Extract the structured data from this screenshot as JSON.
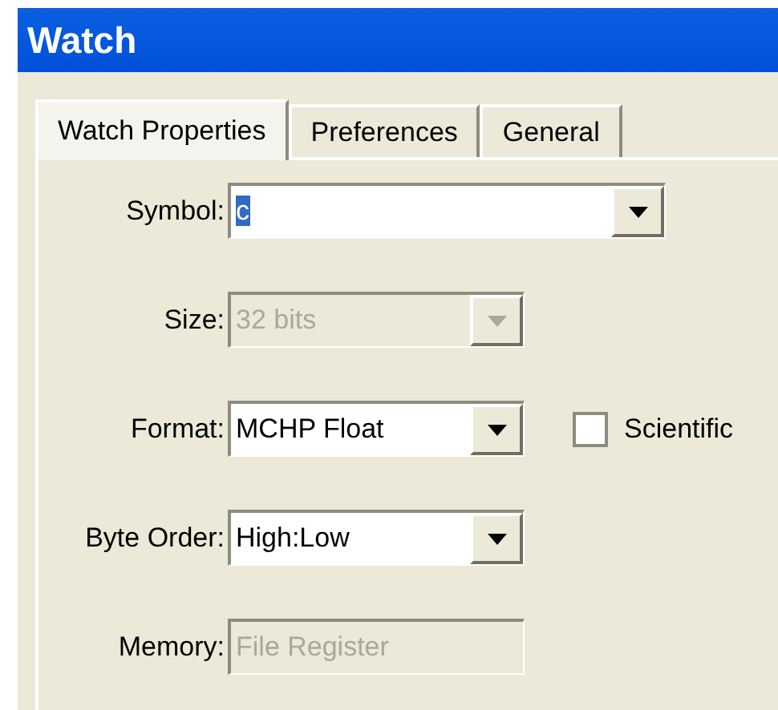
{
  "window": {
    "title": "Watch"
  },
  "tabs": [
    {
      "label": "Watch Properties",
      "selected": true
    },
    {
      "label": "Preferences",
      "selected": false
    },
    {
      "label": "General",
      "selected": false
    }
  ],
  "fields": [
    {
      "kind": "combo",
      "label": "Symbol:",
      "value": "c",
      "disabled": false,
      "text_selected": true,
      "wide": true
    },
    {
      "kind": "combo",
      "label": "Size:",
      "value": "32 bits",
      "disabled": true,
      "text_selected": false,
      "wide": false
    },
    {
      "kind": "combo",
      "label": "Format:",
      "value": "MCHP Float",
      "disabled": false,
      "text_selected": false,
      "wide": false,
      "checkbox": {
        "label": "Scientific",
        "checked": false
      }
    },
    {
      "kind": "combo",
      "label": "Byte Order:",
      "value": "High:Low",
      "disabled": false,
      "text_selected": false,
      "wide": false
    },
    {
      "kind": "text",
      "label": "Memory:",
      "value": "File Register",
      "disabled": true,
      "text_selected": false,
      "wide": false
    }
  ]
}
